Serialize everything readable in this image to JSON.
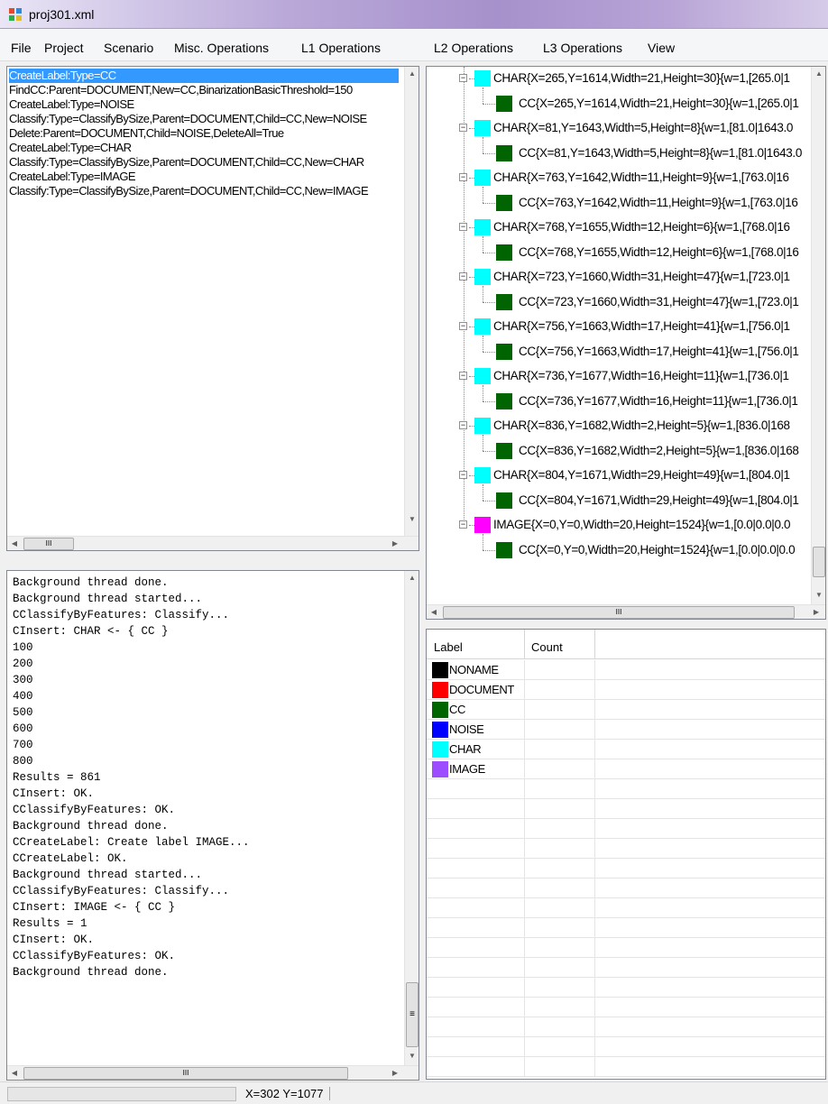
{
  "window": {
    "title": "proj301.xml"
  },
  "menu": [
    "File",
    "Project",
    "Scenario",
    "Misc. Operations",
    "L1 Operations",
    "L2 Operations",
    "L3 Operations",
    "View"
  ],
  "script": {
    "selected_index": 0,
    "lines": [
      "CreateLabel:Type=CC",
      "FindCC:Parent=DOCUMENT,New=CC,BinarizationBasicThreshold=150",
      "CreateLabel:Type=NOISE",
      "Classify:Type=ClassifyBySize,Parent=DOCUMENT,Child=CC,New=NOISE",
      "Delete:Parent=DOCUMENT,Child=NOISE,DeleteAll=True",
      "CreateLabel:Type=CHAR",
      "Classify:Type=ClassifyBySize,Parent=DOCUMENT,Child=CC,New=CHAR",
      "CreateLabel:Type=IMAGE",
      "Classify:Type=ClassifyBySize,Parent=DOCUMENT,Child=CC,New=IMAGE"
    ],
    "hscroll_thumb_glyph": "III"
  },
  "log": {
    "lines": [
      "Background thread done.",
      "Background thread started...",
      "CClassifyByFeatures: Classify...",
      "CInsert: CHAR <- { CC }",
      "100",
      "200",
      "300",
      "400",
      "500",
      "600",
      "700",
      "800",
      "Results = 861",
      "CInsert: OK.",
      "CClassifyByFeatures: OK.",
      "Background thread done.",
      "CCreateLabel: Create label IMAGE...",
      "CCreateLabel: OK.",
      "Background thread started...",
      "CClassifyByFeatures: Classify...",
      "CInsert: IMAGE <- { CC }",
      "Results = 1",
      "CInsert: OK.",
      "CClassifyByFeatures: OK.",
      "Background thread done."
    ],
    "hscroll_thumb_glyph": "III",
    "vscroll_thumb_glyph": "≡"
  },
  "tree": {
    "expander_glyph": "−",
    "hscroll_thumb_glyph": "III",
    "nodes": [
      {
        "text": "CHAR{X=265,Y=1614,Width=21,Height=30}{w=1,[265.0|1",
        "color": "#00ffff",
        "level": 0
      },
      {
        "text": "CC{X=265,Y=1614,Width=21,Height=30}{w=1,[265.0|1",
        "color": "#006400",
        "level": 1
      },
      {
        "text": "CHAR{X=81,Y=1643,Width=5,Height=8}{w=1,[81.0|1643.0",
        "color": "#00ffff",
        "level": 0
      },
      {
        "text": "CC{X=81,Y=1643,Width=5,Height=8}{w=1,[81.0|1643.0",
        "color": "#006400",
        "level": 1
      },
      {
        "text": "CHAR{X=763,Y=1642,Width=11,Height=9}{w=1,[763.0|16",
        "color": "#00ffff",
        "level": 0
      },
      {
        "text": "CC{X=763,Y=1642,Width=11,Height=9}{w=1,[763.0|16",
        "color": "#006400",
        "level": 1
      },
      {
        "text": "CHAR{X=768,Y=1655,Width=12,Height=6}{w=1,[768.0|16",
        "color": "#00ffff",
        "level": 0
      },
      {
        "text": "CC{X=768,Y=1655,Width=12,Height=6}{w=1,[768.0|16",
        "color": "#006400",
        "level": 1
      },
      {
        "text": "CHAR{X=723,Y=1660,Width=31,Height=47}{w=1,[723.0|1",
        "color": "#00ffff",
        "level": 0
      },
      {
        "text": "CC{X=723,Y=1660,Width=31,Height=47}{w=1,[723.0|1",
        "color": "#006400",
        "level": 1
      },
      {
        "text": "CHAR{X=756,Y=1663,Width=17,Height=41}{w=1,[756.0|1",
        "color": "#00ffff",
        "level": 0
      },
      {
        "text": "CC{X=756,Y=1663,Width=17,Height=41}{w=1,[756.0|1",
        "color": "#006400",
        "level": 1
      },
      {
        "text": "CHAR{X=736,Y=1677,Width=16,Height=11}{w=1,[736.0|1",
        "color": "#00ffff",
        "level": 0
      },
      {
        "text": "CC{X=736,Y=1677,Width=16,Height=11}{w=1,[736.0|1",
        "color": "#006400",
        "level": 1
      },
      {
        "text": "CHAR{X=836,Y=1682,Width=2,Height=5}{w=1,[836.0|168",
        "color": "#00ffff",
        "level": 0
      },
      {
        "text": "CC{X=836,Y=1682,Width=2,Height=5}{w=1,[836.0|168",
        "color": "#006400",
        "level": 1
      },
      {
        "text": "CHAR{X=804,Y=1671,Width=29,Height=49}{w=1,[804.0|1",
        "color": "#00ffff",
        "level": 0
      },
      {
        "text": "CC{X=804,Y=1671,Width=29,Height=49}{w=1,[804.0|1",
        "color": "#006400",
        "level": 1
      },
      {
        "text": "IMAGE{X=0,Y=0,Width=20,Height=1524}{w=1,[0.0|0.0|0.0",
        "color": "#ff00ff",
        "level": 0
      },
      {
        "text": "CC{X=0,Y=0,Width=20,Height=1524}{w=1,[0.0|0.0|0.0",
        "color": "#006400",
        "level": 1
      }
    ]
  },
  "labels": {
    "columns": {
      "label": "Label",
      "count": "Count"
    },
    "rows": [
      {
        "name": "NONAME",
        "color": "#000000",
        "count": ""
      },
      {
        "name": "DOCUMENT",
        "color": "#ff0000",
        "count": ""
      },
      {
        "name": "CC",
        "color": "#006400",
        "count": ""
      },
      {
        "name": "NOISE",
        "color": "#0000ff",
        "count": ""
      },
      {
        "name": "CHAR",
        "color": "#00ffff",
        "count": ""
      },
      {
        "name": "IMAGE",
        "color": "#9b4dff",
        "count": ""
      }
    ]
  },
  "status": {
    "coords": "X=302 Y=1077"
  }
}
